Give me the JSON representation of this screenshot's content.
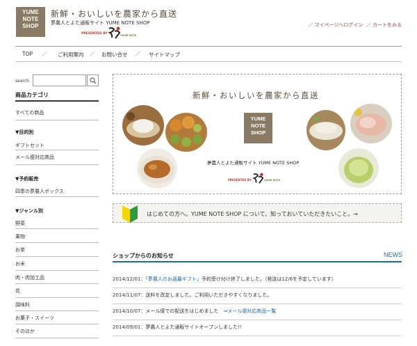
{
  "header": {
    "logo_lines": [
      "YUME",
      "NOTE",
      "SHOP"
    ],
    "tagline": "新鮮・おいしいを農家から直送",
    "subtitle": "夢農人とよた通販サイト YUME NOTE SHOP",
    "presented_by": "PRESENTED BY",
    "presented_brand": "YUME NOTE",
    "links": {
      "mypage": "／ マイページへログイン",
      "cart": "／ カートをみる"
    }
  },
  "nav": {
    "items": [
      "TOP",
      "ご利用案内",
      "お問い合せ",
      "サイトマップ"
    ],
    "separator": "／"
  },
  "sidebar": {
    "search_label": "search",
    "category_title": "商品カテゴリ",
    "all_products": "すべての商品",
    "sections": [
      {
        "heading": "▼目的別",
        "items": [
          "ギフトセット",
          "メール便対応商品"
        ]
      },
      {
        "heading": "▼予約販売",
        "items": [
          "四季の夢農人ボックス"
        ]
      },
      {
        "heading": "▼ジャンル別",
        "items": [
          "野菜",
          "果物",
          "お茶",
          "お米",
          "肉・肉加工品",
          "花",
          "調味料",
          "お菓子・スイーツ",
          "そのほか"
        ]
      }
    ]
  },
  "banner": {
    "title": "新鮮・おいしいを農家から直送",
    "logo_lines": [
      "YUME",
      "NOTE",
      "SHOP"
    ],
    "subtitle": "夢農人とよた通販サイト YUME NOTE SHOP",
    "presented_by": "PRESENTED BY",
    "presented_brand": "YUME NOTE"
  },
  "guide": {
    "text": "はじめての方へ。YUME NOTE SHOP について、知っておいていただきたいこと。→"
  },
  "news": {
    "heading": "ショップからのお知らせ",
    "label": "NEWS",
    "items": [
      {
        "date": "2014/12/01：",
        "link": "「夢農人のお歳暮ギフト」",
        "text": "予約受け付け終了しました。（発送は12/6を予定しています）"
      },
      {
        "date": "2014/11/07：",
        "link": "",
        "text": "送料を改定しました。ご利用いただきやすくなりました。"
      },
      {
        "date": "2014/10/07：",
        "link": "",
        "text": "メール便での配送をはじめました　",
        "link2": "⇒メール便対応商品一覧"
      },
      {
        "date": "2014/09/01：",
        "link": "",
        "text": "夢農人とよた通販サイトオープンしました!!"
      }
    ]
  },
  "colors": {
    "accent_link": "#1a6aa8",
    "header_link": "#c0392b",
    "logo_bg": "#8a7a64"
  }
}
